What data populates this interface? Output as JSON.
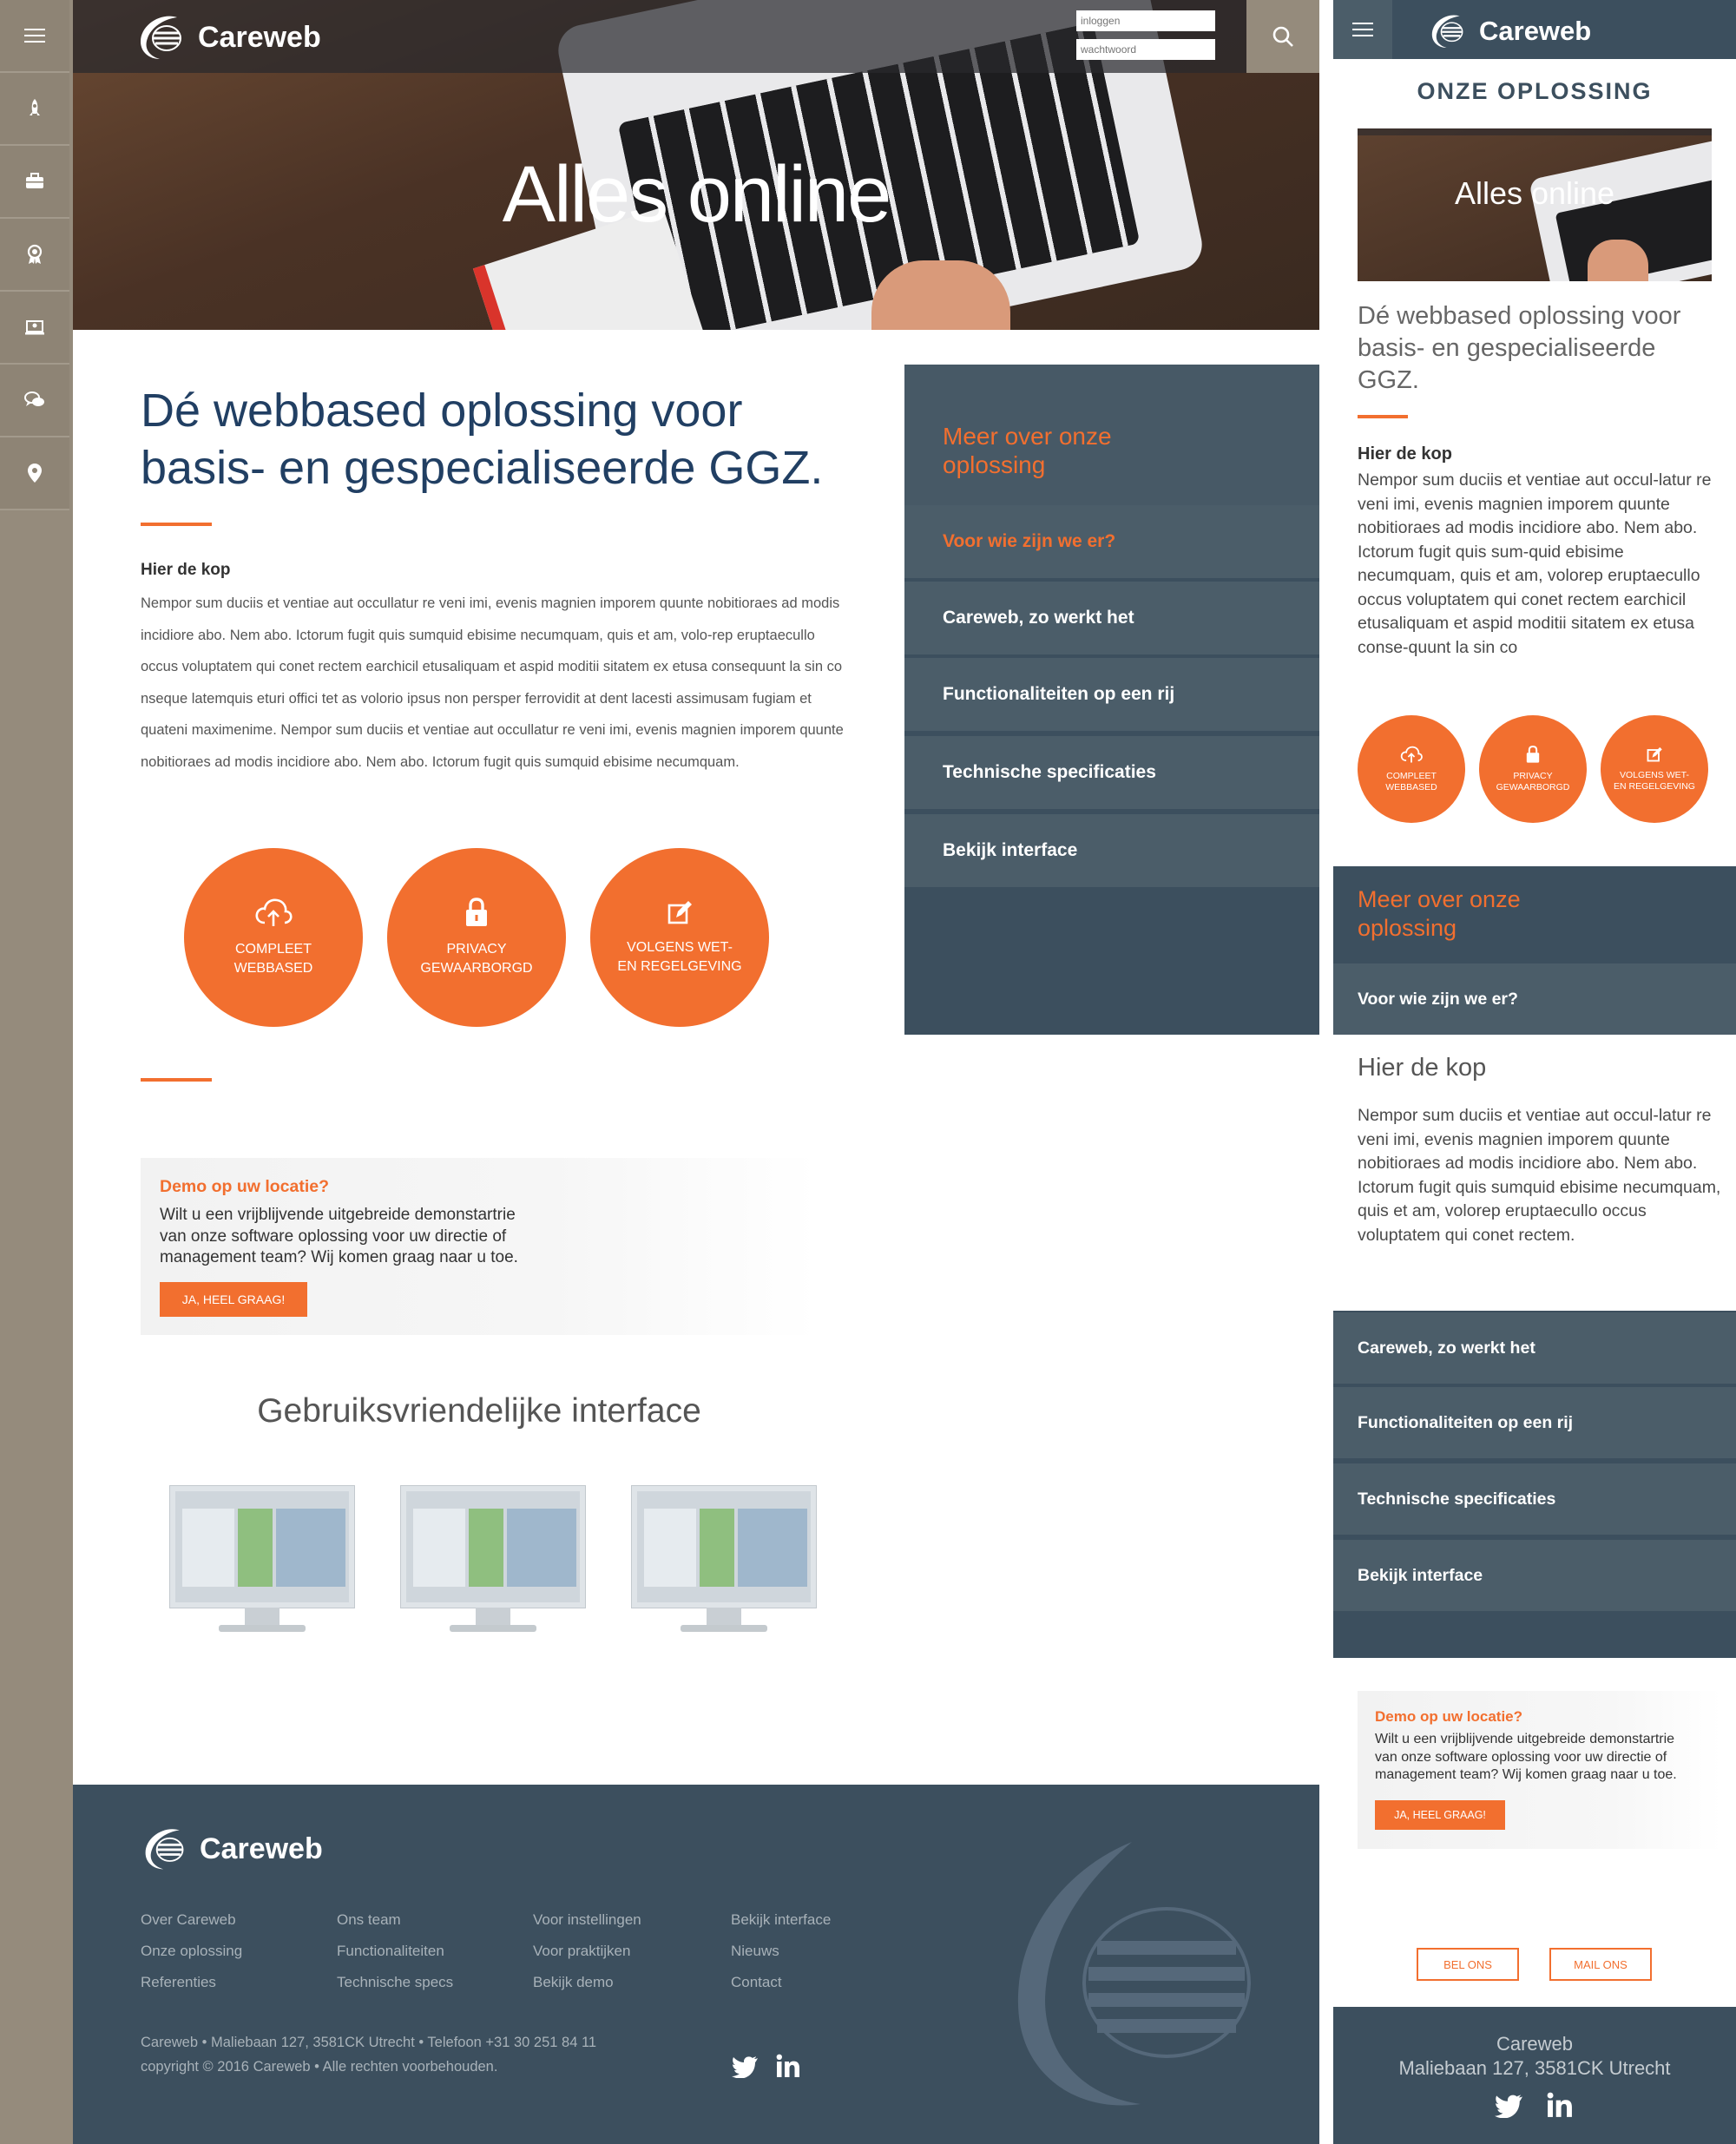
{
  "brand": {
    "name": "Careweb"
  },
  "colors": {
    "accent": "#f26f2f",
    "navy": "#3c4f5e",
    "rail": "#958b7c",
    "heading": "#213f63"
  },
  "rail": {
    "items": [
      "menu-icon",
      "rocket-icon",
      "briefcase-icon",
      "award-icon",
      "presentation-icon",
      "chat-icon",
      "map-pin-icon"
    ]
  },
  "login": {
    "user_placeholder": "inloggen",
    "pass_placeholder": "wachtwoord"
  },
  "hero": {
    "title": "Alles online"
  },
  "intro": {
    "title_line1": "Dé webbased oplossing voor",
    "title_line2": "basis- en gespecialiseerde GGZ.",
    "subhead": "Hier de kop",
    "body": "Nempor sum duciis et ventiae aut occullatur re veni imi, evenis magnien imporem quunte nobitioraes ad modis incidiore abo. Nem abo. Ictorum fugit quis sumquid ebisime necumquam, quis et am, volo-rep eruptaecullo occus voluptatem qui conet rectem earchicil etusaliquam et aspid moditii sitatem ex etusa consequunt la sin co nseque latemquis eturi offici tet as volorio ipsus non persper ferrovidit at dent lacesti assimusam fugiam et quateni maximenime. Nempor sum duciis et ventiae aut occullatur re veni imi, evenis magnien imporem quunte nobitioraes ad modis incidiore abo. Nem abo. Ictorum fugit quis sumquid ebisime necumquam."
  },
  "features": [
    {
      "icon": "cloud-upload-icon",
      "line1": "COMPLEET",
      "line2": "WEBBASED"
    },
    {
      "icon": "lock-icon",
      "line1": "PRIVACY",
      "line2": "GEWAARBORGD"
    },
    {
      "icon": "edit-icon",
      "line1": "VOLGENS WET-",
      "line2": "EN REGELGEVING"
    }
  ],
  "sidenav": {
    "heading_line1": "Meer over onze",
    "heading_line2": "oplossing",
    "items": [
      "Voor wie zijn we er?",
      "Careweb, zo werkt het",
      "Functionaliteiten op een rij",
      "Technische specificaties",
      "Bekijk interface"
    ]
  },
  "demo": {
    "title": "Demo op uw locatie?",
    "line1": "Wilt u een vrijblijvende uitgebreide demonstartrie",
    "line2": "van onze software oplossing voor uw directie of",
    "line3": "management team? Wij komen graag naar u toe.",
    "button": "JA, HEEL GRAAG!"
  },
  "interface": {
    "title": "Gebruiksvriendelijke interface"
  },
  "footer": {
    "columns": [
      [
        "Over Careweb",
        "Onze oplossing",
        "Referenties"
      ],
      [
        "Ons team",
        "Functionaliteiten",
        "Technische specs"
      ],
      [
        "Voor instellingen",
        "Voor praktijken",
        "Bekijk demo"
      ],
      [
        "Bekijk interface",
        "Nieuws",
        "Contact"
      ]
    ],
    "address": "Careweb  •  Maliebaan 127, 3581CK Utrecht  •  Telefoon +31 30 251 84 11",
    "copyright": "copyright © 2016 Careweb  • Alle rechten voorbehouden.",
    "social": [
      "twitter-icon",
      "linkedin-icon"
    ]
  },
  "mobile": {
    "section_title": "ONZE OPLOSSING",
    "hero_title": "Alles online",
    "intro_line1": "Dé webbased oplossing voor",
    "intro_line2": "basis- en gespecialiseerde",
    "intro_line3": "GGZ.",
    "subhead": "Hier de kop",
    "body": "Nempor sum duciis et ventiae aut occul-latur re veni imi, evenis magnien imporem quunte nobitioraes ad modis incidiore abo. Nem abo. Ictorum fugit quis sum-quid ebisime necumquam, quis et am, volorep eruptaecullo occus voluptatem qui conet rectem earchicil etusaliquam et aspid moditii sitatem ex etusa conse-quunt la sin co",
    "second_head": "Hier de kop",
    "second_body": "Nempor sum duciis et ventiae aut occul-latur re veni imi, evenis magnien imporem quunte nobitioraes ad modis incidiore abo. Nem abo. Ictorum fugit quis sumquid ebisime necumquam, quis et am, volorep eruptaecullo occus voluptatem qui conet rectem.",
    "bel": "BEL ONS",
    "mail": "MAIL ONS",
    "foot_name": "Careweb",
    "foot_address": "Maliebaan 127, 3581CK Utrecht"
  }
}
